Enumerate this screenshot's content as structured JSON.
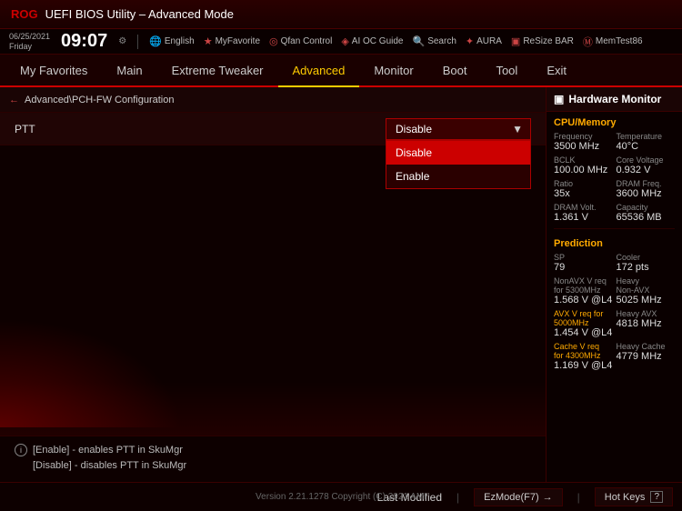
{
  "titleBar": {
    "logo": "ROG",
    "title": "UEFI BIOS Utility – Advanced Mode"
  },
  "infoBar": {
    "date": "06/25/2021",
    "dayOfWeek": "Friday",
    "time": "09:07",
    "gearIcon": "⚙",
    "toolbarItems": [
      {
        "icon": "🌐",
        "label": "English"
      },
      {
        "icon": "★",
        "label": "MyFavorite"
      },
      {
        "icon": "🔧",
        "label": "Qfan Control"
      },
      {
        "icon": "🤖",
        "label": "AI OC Guide"
      },
      {
        "icon": "🔍",
        "label": "Search"
      },
      {
        "icon": "✦",
        "label": "AURA"
      },
      {
        "icon": "▣",
        "label": "ReSize BAR"
      },
      {
        "icon": "M",
        "label": "MemTest86"
      }
    ]
  },
  "nav": {
    "items": [
      {
        "id": "my-favorites",
        "label": "My Favorites",
        "active": false
      },
      {
        "id": "main",
        "label": "Main",
        "active": false
      },
      {
        "id": "extreme-tweaker",
        "label": "Extreme Tweaker",
        "active": false
      },
      {
        "id": "advanced",
        "label": "Advanced",
        "active": true
      },
      {
        "id": "monitor",
        "label": "Monitor",
        "active": false
      },
      {
        "id": "boot",
        "label": "Boot",
        "active": false
      },
      {
        "id": "tool",
        "label": "Tool",
        "active": false
      },
      {
        "id": "exit",
        "label": "Exit",
        "active": false
      }
    ]
  },
  "breadcrumb": {
    "backLabel": "←",
    "path": "Advanced\\PCH-FW Configuration"
  },
  "settingRow": {
    "label": "PTT",
    "currentValue": "Disable",
    "dropdownOpen": true,
    "options": [
      {
        "label": "Disable",
        "selected": false,
        "highlighted": false
      },
      {
        "label": "Enable",
        "selected": false,
        "highlighted": false
      }
    ]
  },
  "infoSection": {
    "lines": [
      "[Enable] - enables PTT in SkuMgr",
      "[Disable] - disables PTT in SkuMgr"
    ],
    "icon": "i"
  },
  "hwMonitor": {
    "title": "Hardware Monitor",
    "monitorIcon": "□",
    "sections": [
      {
        "id": "cpu-memory",
        "title": "CPU/Memory",
        "rows": [
          {
            "label1": "Frequency",
            "value1": "3500 MHz",
            "label2": "Temperature",
            "value2": "40°C"
          },
          {
            "label1": "BCLK",
            "value1": "100.00 MHz",
            "label2": "Core Voltage",
            "value2": "0.932 V"
          },
          {
            "label1": "Ratio",
            "value1": "35x",
            "label2": "DRAM Freq.",
            "value2": "3600 MHz"
          },
          {
            "label1": "DRAM Volt.",
            "value1": "1.361 V",
            "label2": "Capacity",
            "value2": "65536 MB"
          }
        ]
      },
      {
        "id": "prediction",
        "title": "Prediction",
        "rows": [
          {
            "label1": "SP",
            "value1": "79",
            "label2": "Cooler",
            "value2": "172 pts"
          },
          {
            "label1": "NonAVX V req\nfor 5300MHz",
            "value1": "1.568 V @L4",
            "label2": "Heavy\nNon-AVX",
            "value2": "5025 MHz",
            "value1Yellow": false
          },
          {
            "label1": "AVX V req for\n5000MHz",
            "value1": "1.454 V @L4",
            "label2": "Heavy AVX",
            "value2": "4818 MHz",
            "label1Yellow": true
          },
          {
            "label1": "Cache V req\nfor 4300MHz",
            "value1": "1.169 V @L4",
            "label2": "Heavy Cache",
            "value2": "4779 MHz",
            "label1Yellow": true
          }
        ]
      }
    ]
  },
  "statusBar": {
    "version": "Version 2.21.1278 Copyright (C) 2021 AMI",
    "lastModified": "Last Modified",
    "ezMode": "EzMode(F7)",
    "hotKeys": "Hot Keys",
    "questionMark": "?"
  }
}
